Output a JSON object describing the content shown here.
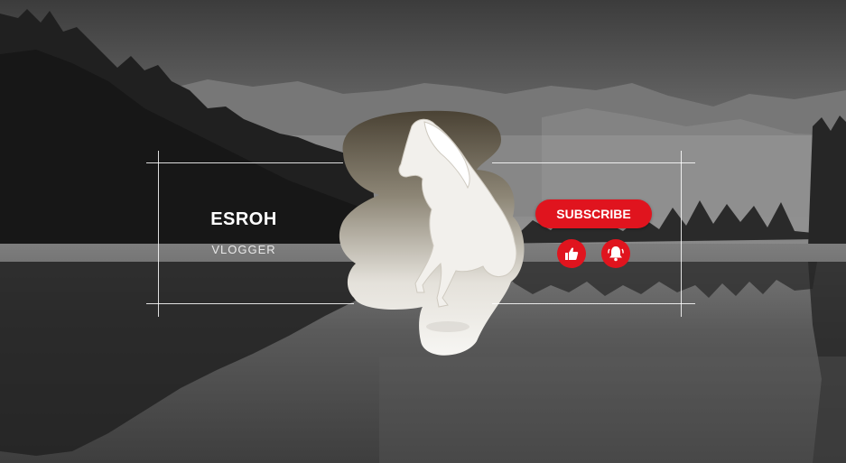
{
  "channel": {
    "name": "ESROH",
    "role": "VLOGGER"
  },
  "actions": {
    "subscribe_label": "SUBSCRIBE",
    "like_icon": "thumbs-up-icon",
    "bell_icon": "bell-icon"
  },
  "colors": {
    "accent": "#e0141e",
    "frame": "#ffffff",
    "background": "#4a4a4a"
  }
}
